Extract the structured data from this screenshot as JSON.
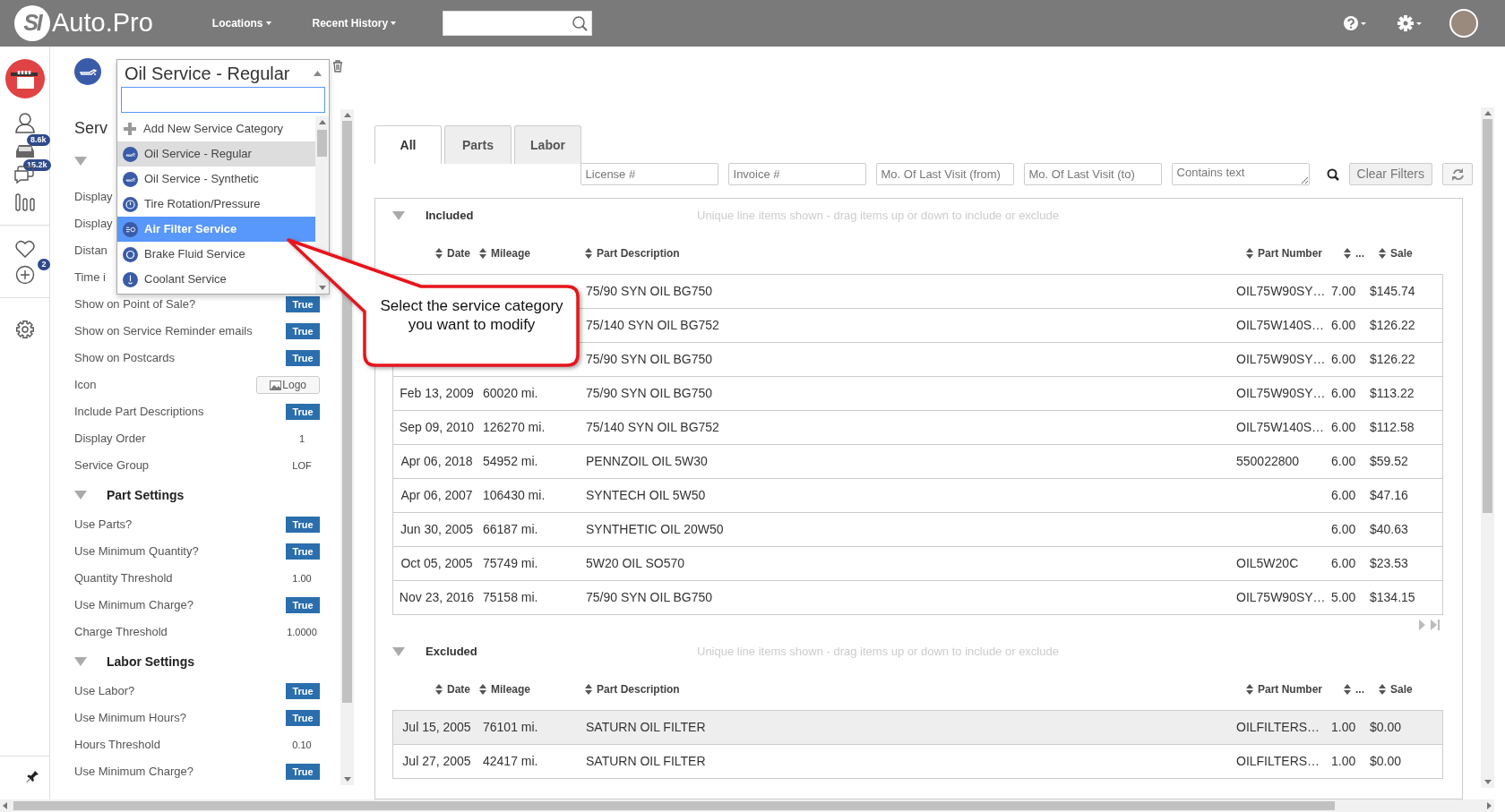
{
  "navbar": {
    "logo_mark": "SI",
    "logo_text": "Auto.Pro",
    "menus": [
      "Locations",
      "Recent History"
    ]
  },
  "rail": {
    "items": [
      {
        "kind": "shop"
      },
      {
        "kind": "customers",
        "badge": "8.6k"
      },
      {
        "kind": "vehicles",
        "badge": "15.2k"
      },
      {
        "kind": "messages"
      },
      {
        "kind": "reports"
      },
      {
        "kind": "divider"
      },
      {
        "kind": "favorites",
        "badge": "2"
      },
      {
        "kind": "add"
      },
      {
        "kind": "divider"
      },
      {
        "kind": "settings"
      },
      {
        "kind": "divider"
      },
      {
        "kind": "pin"
      }
    ]
  },
  "service_selector": {
    "value": "Oil Service - Regular",
    "expanded": true,
    "options": [
      {
        "label": "Add New Service Category",
        "kind": "add",
        "selected": false,
        "highlighted": false
      },
      {
        "label": "Oil Service - Regular",
        "kind": "oil",
        "selected": true,
        "highlighted": false
      },
      {
        "label": "Oil Service - Synthetic",
        "kind": "oil",
        "selected": false,
        "highlighted": false
      },
      {
        "label": "Tire Rotation/Pressure",
        "kind": "tire",
        "selected": false,
        "highlighted": false
      },
      {
        "label": "Air Filter Service",
        "kind": "air",
        "selected": false,
        "highlighted": true
      },
      {
        "label": "Brake Fluid Service",
        "kind": "brake",
        "selected": false,
        "highlighted": false
      },
      {
        "label": "Coolant Service",
        "kind": "coolant",
        "selected": false,
        "highlighted": false
      }
    ]
  },
  "settings": {
    "rows": [
      {
        "kind": "heading",
        "label": "Serv"
      },
      {
        "kind": "section",
        "expanded": true
      },
      {
        "kind": "field",
        "label": "Display"
      },
      {
        "kind": "field",
        "label": "Display"
      },
      {
        "kind": "field",
        "label": "Distan"
      },
      {
        "kind": "field",
        "label": "Time i"
      },
      {
        "kind": "bool",
        "label": "Show on Point of Sale?",
        "value": "True"
      },
      {
        "kind": "bool",
        "label": "Show on Service Reminder emails",
        "value": "True"
      },
      {
        "kind": "bool",
        "label": "Show on Postcards",
        "value": "True"
      },
      {
        "kind": "button",
        "label": "Icon",
        "value": "Logo"
      },
      {
        "kind": "bool",
        "label": "Include Part Descriptions",
        "value": "True"
      },
      {
        "kind": "text",
        "label": "Display Order",
        "value": "1"
      },
      {
        "kind": "text",
        "label": "Service Group",
        "value": "LOF"
      },
      {
        "kind": "section",
        "label": "Part Settings",
        "expanded": true
      },
      {
        "kind": "bool",
        "label": "Use Parts?",
        "value": "True"
      },
      {
        "kind": "bool",
        "label": "Use Minimum Quantity?",
        "value": "True"
      },
      {
        "kind": "text",
        "label": "Quantity Threshold",
        "value": "1.00"
      },
      {
        "kind": "bool",
        "label": "Use Minimum Charge?",
        "value": "True"
      },
      {
        "kind": "text",
        "label": "Charge Threshold",
        "value": "1.0000"
      },
      {
        "kind": "section",
        "label": "Labor Settings",
        "expanded": true
      },
      {
        "kind": "bool",
        "label": "Use Labor?",
        "value": "True"
      },
      {
        "kind": "bool",
        "label": "Use Minimum Hours?",
        "value": "True"
      },
      {
        "kind": "text",
        "label": "Hours Threshold",
        "value": "0.10"
      },
      {
        "kind": "bool",
        "label": "Use Minimum Charge?",
        "value": "True"
      }
    ]
  },
  "tabs": [
    {
      "label": "All",
      "selected": true
    },
    {
      "label": "Parts",
      "selected": false
    },
    {
      "label": "Labor",
      "selected": false
    }
  ],
  "filters": [
    {
      "kind": "input",
      "placeholder": "License #"
    },
    {
      "kind": "input",
      "placeholder": "Invoice #"
    },
    {
      "kind": "input",
      "placeholder": "Mo. Of Last Visit (from)"
    },
    {
      "kind": "input",
      "placeholder": "Mo. Of Last Visit (to)"
    },
    {
      "kind": "textarea",
      "placeholder": "Contains text"
    }
  ],
  "clear_button": "Clear Filters",
  "sections": [
    {
      "title": "Included",
      "expanded": true,
      "hint": "Unique line items shown - drag items up or down to include or exclude",
      "pager": true,
      "columns": [
        "Date",
        "Mileage",
        "Part Description",
        "Part Number",
        "...",
        "Sale"
      ],
      "rows": [
        {
          "description": "75/90 SYN OIL BG750",
          "part_number": "OIL75W90SY…",
          "qty": "7.00",
          "sale": "$145.74",
          "selected": false
        },
        {
          "description": "75/140 SYN OIL BG752",
          "part_number": "OIL75W140S…",
          "qty": "6.00",
          "sale": "$126.22",
          "selected": false
        },
        {
          "description": "75/90 SYN OIL BG750",
          "part_number": "OIL75W90SY…",
          "qty": "6.00",
          "sale": "$126.22",
          "selected": false
        },
        {
          "date": "Feb 13, 2009",
          "mileage": "60020 mi.",
          "description": "75/90 SYN OIL BG750",
          "part_number": "OIL75W90SY…",
          "qty": "6.00",
          "sale": "$113.22",
          "selected": false
        },
        {
          "date": "Sep 09, 2010",
          "mileage": "126270 mi.",
          "description": "75/140 SYN OIL BG752",
          "part_number": "OIL75W140S…",
          "qty": "6.00",
          "sale": "$112.58",
          "selected": false
        },
        {
          "date": "Apr 06, 2018",
          "mileage": "54952 mi.",
          "description": "PENNZOIL OIL 5W30",
          "part_number": "550022800",
          "qty": "6.00",
          "sale": "$59.52",
          "selected": false
        },
        {
          "date": "Apr 06, 2007",
          "mileage": "106430 mi.",
          "description": "SYNTECH OIL 5W50",
          "qty": "6.00",
          "sale": "$47.16",
          "selected": false
        },
        {
          "date": "Jun 30, 2005",
          "mileage": "66187 mi.",
          "description": "SYNTHETIC OIL 20W50",
          "qty": "6.00",
          "sale": "$40.63",
          "selected": false
        },
        {
          "date": "Oct 05, 2005",
          "mileage": "75749 mi.",
          "description": "5W20 OIL SO570",
          "part_number": "OIL5W20C",
          "qty": "6.00",
          "sale": "$23.53",
          "selected": false
        },
        {
          "date": "Nov 23, 2016",
          "mileage": "75158 mi.",
          "description": "75/90 SYN OIL BG750",
          "part_number": "OIL75W90SY…",
          "qty": "5.00",
          "sale": "$134.15",
          "selected": false
        }
      ]
    },
    {
      "title": "Excluded",
      "expanded": true,
      "hint": "Unique line items shown - drag items up or down to include or exclude",
      "pager": false,
      "columns": [
        "Date",
        "Mileage",
        "Part Description",
        "Part Number",
        "...",
        "Sale"
      ],
      "rows": [
        {
          "date": "Jul 15, 2005",
          "mileage": "76101 mi.",
          "description": "SATURN OIL FILTER",
          "part_number": "OILFILTERS…",
          "qty": "1.00",
          "sale": "$0.00",
          "selected": true
        },
        {
          "date": "Jul 27, 2005",
          "mileage": "42417 mi.",
          "description": "SATURN OIL FILTER",
          "part_number": "OILFILTERS…",
          "qty": "1.00",
          "sale": "$0.00",
          "selected": false
        }
      ]
    }
  ],
  "callout": {
    "text": "Select the service category you want to modify"
  }
}
